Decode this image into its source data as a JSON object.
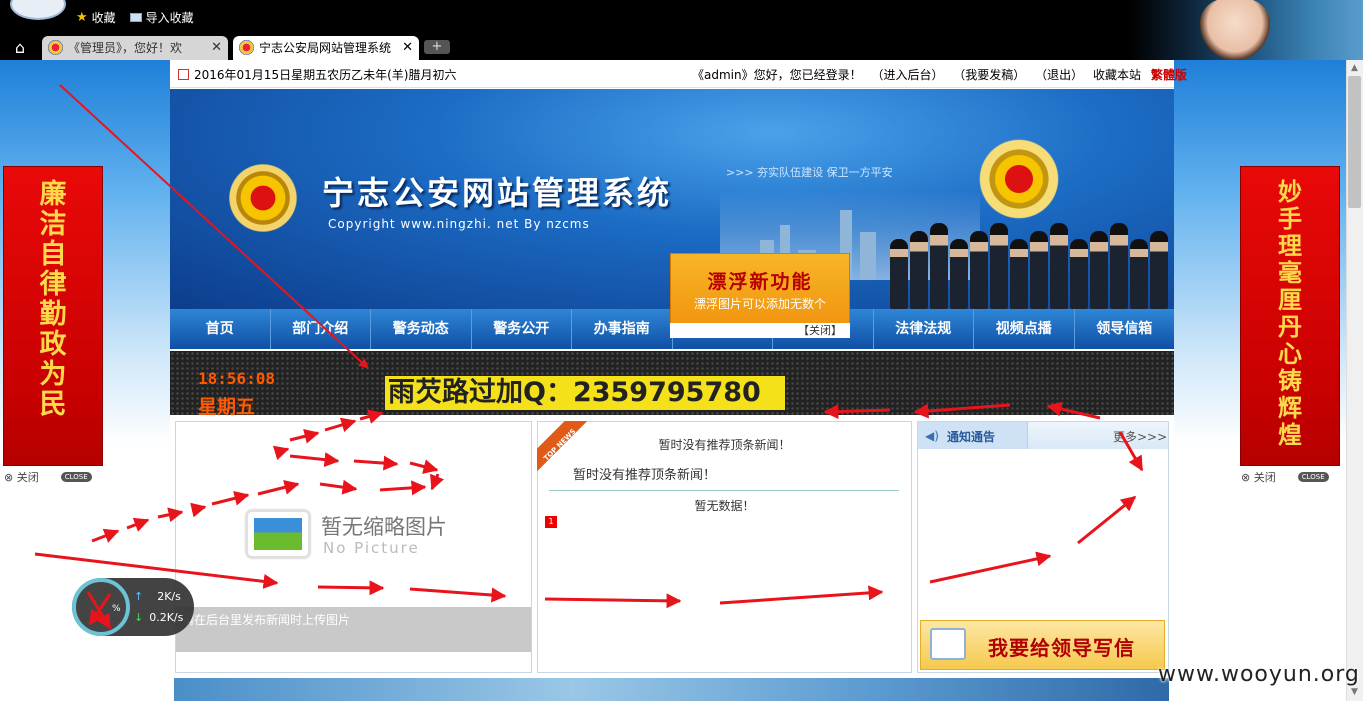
{
  "browser": {
    "bookmarks": [
      {
        "label": "收藏",
        "icon": "star-icon"
      },
      {
        "label": "导入收藏",
        "icon": "folder-icon"
      }
    ],
    "tabs": [
      {
        "title": "《管理员》，您好！欢",
        "active": false
      },
      {
        "title": "宁志公安局网站管理系统",
        "active": true
      }
    ],
    "home_icon": "home-icon",
    "new_tab_symbol": "+",
    "close_symbol": "✕"
  },
  "site": {
    "date_line": "2016年01月15日星期五农历乙未年(羊)腊月初六",
    "login": {
      "user": "《admin》您好，您已经登录！",
      "links": [
        "（进入后台）",
        "（我要发稿）",
        "（退出）",
        "收藏本站"
      ],
      "traditional": "繁體版"
    },
    "title": "宁志公安网站管理系统",
    "copyright": "Copyright  www.ningzhi. net By nzcms",
    "slogan": ">>> 夯实队伍建设 保卫一方平安",
    "nav": [
      "首页",
      "部门介绍",
      "警务动态",
      "警务公开",
      "办事指南",
      "",
      "",
      "法律法规",
      "视频点播",
      "领导信箱"
    ],
    "float_ad": {
      "title": "漂浮新功能",
      "subtitle": "漂浮图片可以添加无数个",
      "close": "【关闭】"
    },
    "ticker": {
      "time": "18:56:08",
      "weekday": "星期五",
      "spam": "雨芡路过加Q：2359795780"
    },
    "left_panel": {
      "no_pic_cn": "暂无缩略图片",
      "no_pic_en": "No Picture",
      "caption": "请在后台里发布新闻时上传图片"
    },
    "mid_panel": {
      "badge": "TOP NEWS",
      "title": "暂时没有推荐顶条新闻！",
      "subtitle": "暂时没有推荐顶条新闻！",
      "no_data": "暂无数据！",
      "num": "1"
    },
    "right_panel": {
      "title": "通知通告",
      "more": "更多>>>",
      "letter_button": "我要给领导写信"
    }
  },
  "couplets": {
    "left": "廉洁自律 勤政为民",
    "right": "妙手理毫厘 丹心铸辉煌",
    "close_label": "⊗ 关闭",
    "close_badge": "CLOSE"
  },
  "speed_widget": {
    "percent": "%",
    "up": "2K/s",
    "down": "0.2K/s"
  },
  "watermark": "www.wooyun.org",
  "colors": {
    "nav_blue": "#0f4fa5",
    "couplet_red": "#c80000",
    "ticker_orange": "#ff5a00",
    "spam_yellow": "#f5e11a",
    "annotation_red": "#e8141c"
  }
}
